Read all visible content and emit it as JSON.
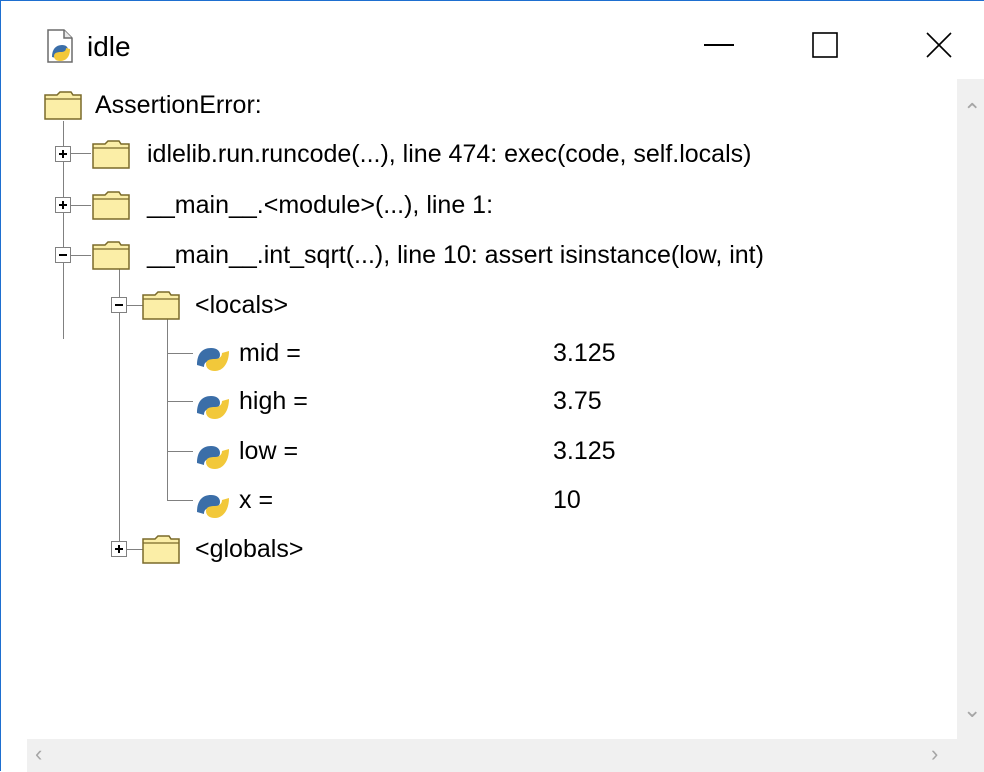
{
  "window": {
    "title": "idle",
    "controls": {
      "minimize": "minimize-icon",
      "maximize": "maximize-icon",
      "close": "close-icon"
    }
  },
  "tree": {
    "root": "AssertionError:",
    "frames": [
      {
        "label": "idlelib.run.runcode(...), line 474: exec(code, self.locals)",
        "expanded": false
      },
      {
        "label": "__main__.<module>(...), line 1:",
        "expanded": false
      },
      {
        "label": "__main__.int_sqrt(...), line 10: assert isinstance(low, int)",
        "expanded": true
      }
    ],
    "locals": {
      "label": "<locals>",
      "expanded": true,
      "vars": [
        {
          "name": "mid =",
          "value": "3.125"
        },
        {
          "name": "high =",
          "value": "3.75"
        },
        {
          "name": "low =",
          "value": "3.125"
        },
        {
          "name": "x =",
          "value": "10"
        }
      ]
    },
    "globals": {
      "label": "<globals>",
      "expanded": false
    }
  },
  "colors": {
    "folder_fill": "#fbeea7",
    "folder_stroke": "#7a6a2a",
    "python_blue": "#3b6ea8",
    "python_yellow": "#f2c83a",
    "tree_line": "#808080",
    "scrollbar": "#f0f0f0"
  }
}
